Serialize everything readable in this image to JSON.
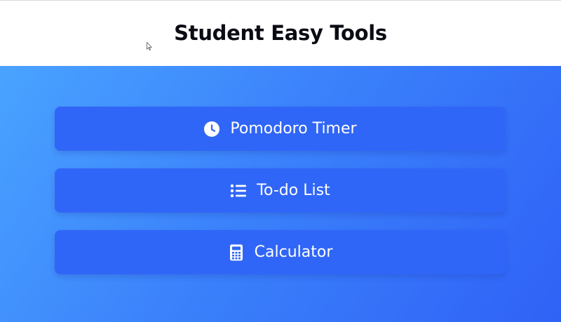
{
  "header": {
    "title": "Student Easy Tools"
  },
  "tools": [
    {
      "label": "Pomodoro Timer",
      "icon": "clock-icon"
    },
    {
      "label": "To-do List",
      "icon": "list-icon"
    },
    {
      "label": "Calculator",
      "icon": "calculator-icon"
    }
  ],
  "colors": {
    "header_bg": "#ffffff",
    "gradient_start": "#4aa3ff",
    "gradient_end": "#2f62f6",
    "button_bg": "#3066f7",
    "button_text": "#ffffff",
    "title_text": "#0b0b14"
  }
}
